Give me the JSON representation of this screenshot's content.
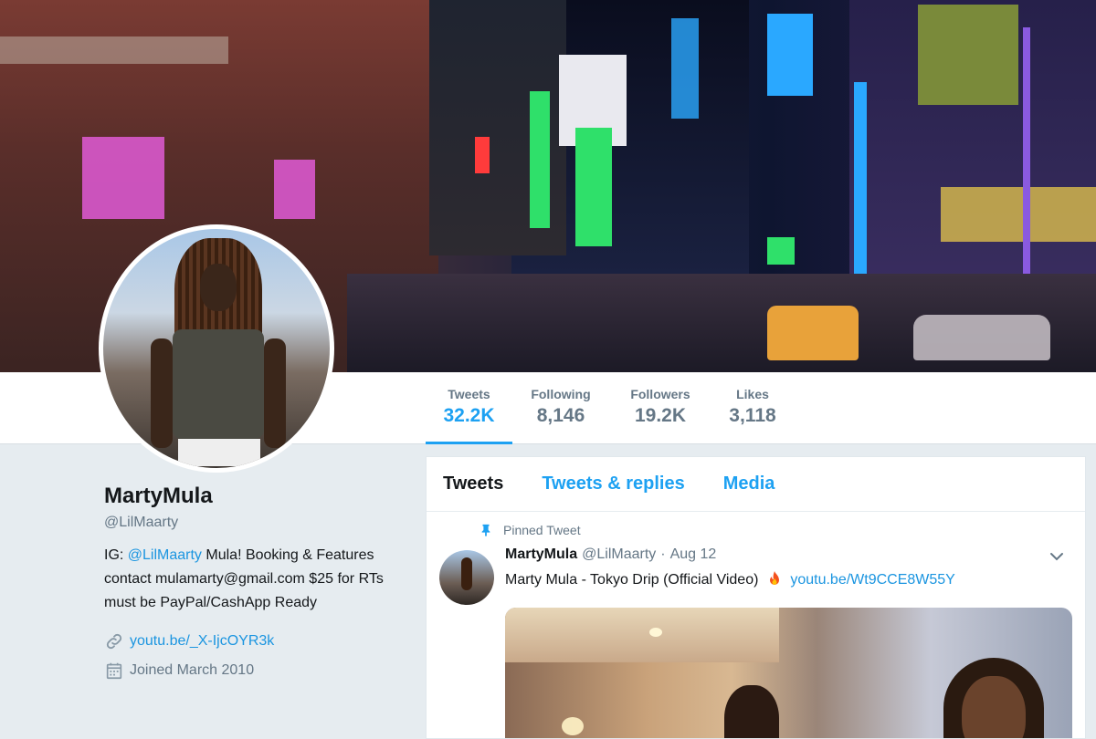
{
  "profile_nav": {
    "stats": [
      {
        "label": "Tweets",
        "value": "32.2K"
      },
      {
        "label": "Following",
        "value": "8,146"
      },
      {
        "label": "Followers",
        "value": "19.2K"
      },
      {
        "label": "Likes",
        "value": "3,118"
      }
    ],
    "active_stat": "Tweets"
  },
  "profile": {
    "name": "MartyMula",
    "handle": "@LilMaarty",
    "bio_prefix": "IG: ",
    "bio_mention": "@LilMaarty",
    "bio_rest": " Mula! Booking & Features contact mulamarty@gmail.com $25 for RTs must be PayPal/CashApp Ready",
    "website": "youtu.be/_X-IjcOYR3k",
    "joined": "Joined March 2010",
    "link_icon": "link-icon",
    "calendar_icon": "calendar-icon"
  },
  "timeline": {
    "tabs": [
      {
        "label": "Tweets"
      },
      {
        "label": "Tweets & replies"
      },
      {
        "label": "Media"
      }
    ],
    "active_tab": "Tweets",
    "pinned_label": "Pinned Tweet",
    "tweet": {
      "name": "MartyMula",
      "handle": "@LilMaarty",
      "separator": "·",
      "date": "Aug 12",
      "text": "Marty Mula - Tokyo Drip (Official Video)",
      "emoji": "fire-emoji",
      "link": "youtu.be/Wt9CCE8W55Y"
    }
  },
  "colors": {
    "accent": "#1da1f2",
    "link": "#1b95e0",
    "muted": "#657786",
    "page_bg": "#e6ecf0"
  }
}
